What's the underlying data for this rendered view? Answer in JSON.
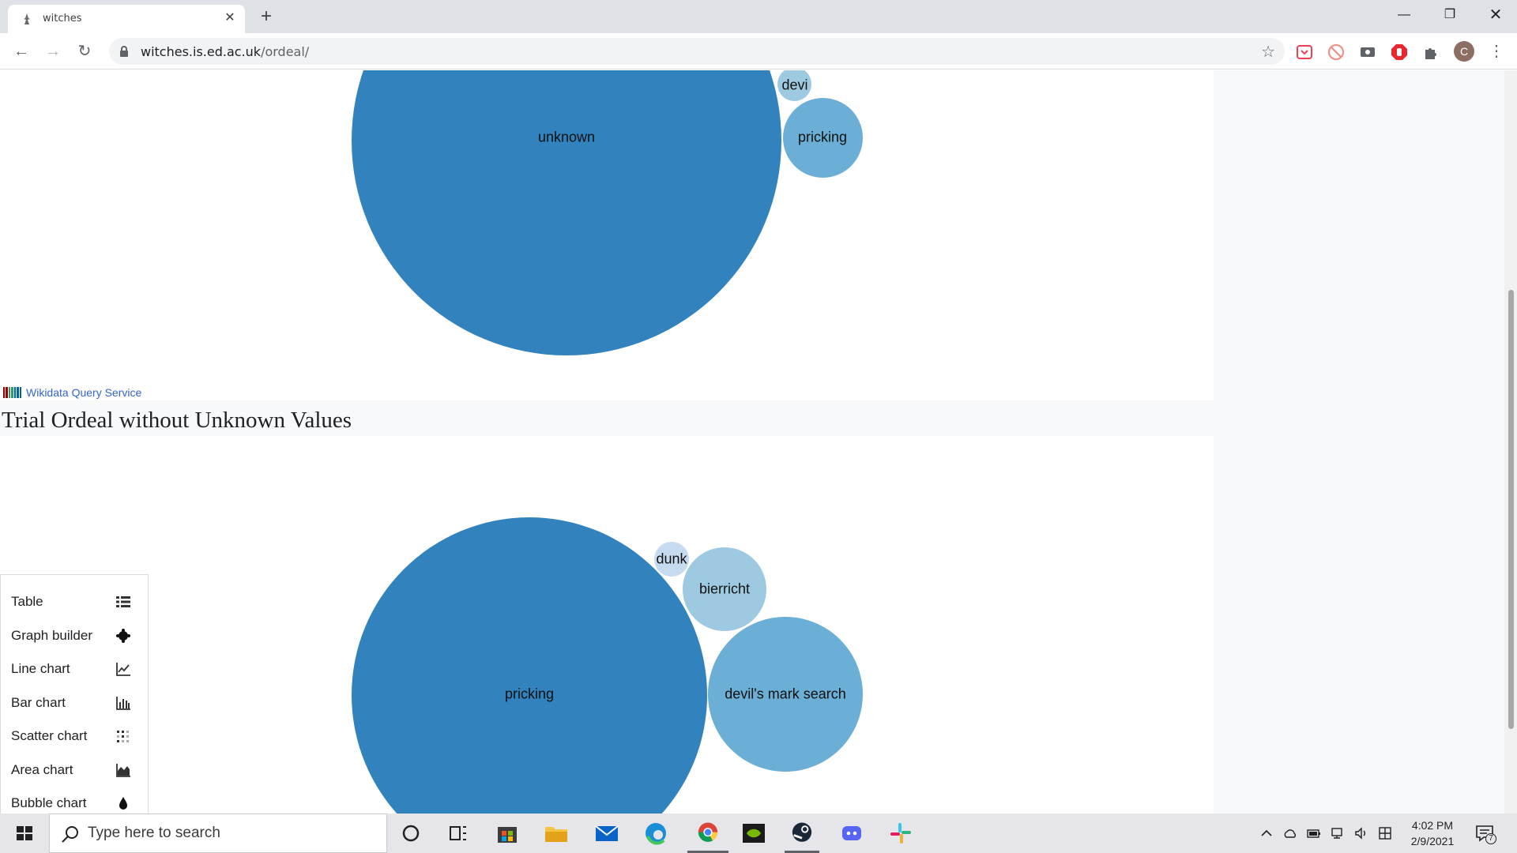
{
  "browser": {
    "tab_title": "witches",
    "url_host": "witches.is.ed.ac.uk",
    "url_path": "/ordeal/",
    "avatar_letter": "C"
  },
  "chart_top": {
    "type": "bubble",
    "bubbles": [
      {
        "label": "unknown",
        "color": "#3182bd"
      },
      {
        "label": "pricking",
        "color": "#6baed6"
      },
      {
        "label": "devi",
        "color": "#9ecae1"
      }
    ]
  },
  "source_link": "Wikidata Query Service",
  "section_title": "Trial Ordeal without Unknown Values",
  "chart_bottom": {
    "type": "bubble",
    "bubbles": [
      {
        "label": "pricking",
        "color": "#3182bd"
      },
      {
        "label": "devil's mark search",
        "color": "#6baed6"
      },
      {
        "label": "bierricht",
        "color": "#9ecae1"
      },
      {
        "label": "dunk",
        "color": "#c6dbef"
      }
    ]
  },
  "view_menu": [
    {
      "label": "Table",
      "icon": "table-list-icon"
    },
    {
      "label": "Graph builder",
      "icon": "graph-builder-icon"
    },
    {
      "label": "Line chart",
      "icon": "line-chart-icon"
    },
    {
      "label": "Bar chart",
      "icon": "bar-chart-icon"
    },
    {
      "label": "Scatter chart",
      "icon": "scatter-chart-icon"
    },
    {
      "label": "Area chart",
      "icon": "area-chart-icon"
    },
    {
      "label": "Bubble chart",
      "icon": "bubble-chart-icon"
    }
  ],
  "taskbar": {
    "search_placeholder": "Type here to search",
    "time": "4:02 PM",
    "date": "2/9/2021",
    "notification_count": "7"
  }
}
